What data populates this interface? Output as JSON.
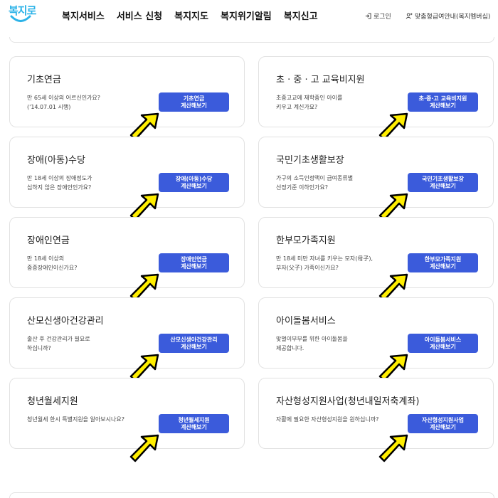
{
  "logo": {
    "text": "복지로",
    "color": "#2db3e8"
  },
  "nav": [
    "복지서비스",
    "서비스 신청",
    "복지지도",
    "복지위기알림",
    "복지신고"
  ],
  "util": {
    "login": "로그인",
    "member": "맞춤형급여안내(복지멤버십)"
  },
  "accent_color": "#3b5bdb",
  "arrow_color": "#ffee00",
  "cards": [
    {
      "title": "기초연금",
      "desc": "만 65세 이상의 어르신인가요?\n('14.07.01 시행)",
      "btn1": "기초연금",
      "btn2": "계산해보기"
    },
    {
      "title": "초 · 중 · 고 교육비지원",
      "desc": "초중고교에 재학중인 아이를\n키우고 계신가요?",
      "btn1": "초·중·고 교육비지원",
      "btn2": "계산해보기"
    },
    {
      "title": "장애(아동)수당",
      "desc": "만 18세 이상의 장애정도가\n심하지 않은 장애인인가요?",
      "btn1": "장애(아동)수당",
      "btn2": "계산해보기"
    },
    {
      "title": "국민기초생활보장",
      "desc": "가구의 소득인정액이 급여종류별\n선정기준 이하인가요?",
      "btn1": "국민기초생활보장",
      "btn2": "계산해보기"
    },
    {
      "title": "장애인연금",
      "desc": "만 18세 이상의\n중증장애인이신가요?",
      "btn1": "장애인연금",
      "btn2": "계산해보기"
    },
    {
      "title": "한부모가족지원",
      "desc": "만 18세 미만 자녀를 키우는 모자(母子),\n부자(父子) 가족이신가요?",
      "btn1": "한부모가족지원",
      "btn2": "계산해보기"
    },
    {
      "title": "산모신생아건강관리",
      "desc": "출산 후 건강관리가 필요로\n하십니까?",
      "btn1": "산모신생아건강관리",
      "btn2": "계산해보기"
    },
    {
      "title": "아이돌봄서비스",
      "desc": "맞벌이부부를 위한 아이돌봄을\n제공합니다.",
      "btn1": "아이돌봄서비스",
      "btn2": "계산해보기"
    },
    {
      "title": "청년월세지원",
      "desc": "청년월세 한시 특별지원을 알아보시나요?",
      "btn1": "청년월세지원",
      "btn2": "계산해보기"
    },
    {
      "title": "자산형성지원사업(청년내일저축계좌)",
      "desc": "자활에 필요한 자산형성지원을 원하십니까?",
      "btn1": "자산형성지원사업",
      "btn2": "계산해보기"
    }
  ]
}
